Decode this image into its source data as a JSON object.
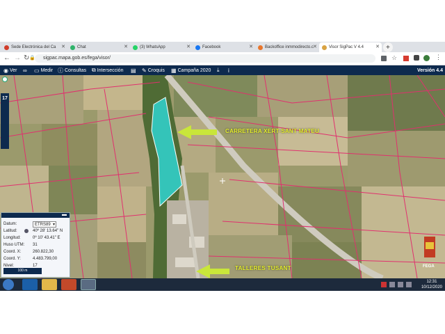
{
  "browser": {
    "tabs": [
      {
        "label": "Sede Electrónica del Ca",
        "fav_color": "#d03d2b"
      },
      {
        "label": "Chat",
        "fav_color": "#2fb36a"
      },
      {
        "label": "(3) WhatsApp",
        "fav_color": "#25d366"
      },
      {
        "label": "Facebook",
        "fav_color": "#1877f2"
      },
      {
        "label": "Backoffice inmmodirecto.c",
        "fav_color": "#e8762d"
      },
      {
        "label": "Visor SigPac V 4.4",
        "fav_color": "#d9a343"
      }
    ],
    "new_tab": "+",
    "url": "sigpac.mapa.gob.es/fega/visor/"
  },
  "toolbar": {
    "items": [
      {
        "label": "Ver",
        "icon": "eye-icon"
      },
      {
        "label": "",
        "icon": "binoculars-icon"
      },
      {
        "label": "Medir",
        "icon": "ruler-icon"
      },
      {
        "label": "Consultas",
        "icon": "info-icon"
      },
      {
        "label": "Intersección",
        "icon": "intersection-icon"
      },
      {
        "label": "",
        "icon": "print-icon"
      },
      {
        "label": "Croquis",
        "icon": "pencil-icon"
      },
      {
        "label": "Campaña 2020",
        "icon": "calendar-icon"
      },
      {
        "label": "",
        "icon": "download-icon"
      },
      {
        "label": "",
        "icon": "info-small-icon"
      }
    ],
    "version": "Versión 4.4"
  },
  "zoom_level": "17",
  "map": {
    "label_road": "CARRETERA XERT-SANT MATEU",
    "label_workshop": "TALLERES TUSANT",
    "parcel_color": "#2fd3d0",
    "arrow_color": "#c9e63a",
    "boundary_color": "#e0306e",
    "logo": "FEGA"
  },
  "coords": {
    "datum_label": "Datum:",
    "datum_value": "ETRS89",
    "lat_label": "Latitud:",
    "lat_value": "40º 28' 13.64\" N",
    "lon_label": "Longitud:",
    "lon_value": "0º 10' 43.41\" E",
    "huso_label": "Huso UTM:",
    "huso_value": "31",
    "x_label": "Coord. X:",
    "x_value": "260.822,30",
    "y_label": "Coord. Y:",
    "y_value": "4.483.799,00",
    "nivel_label": "Nivel:",
    "nivel_value": "17",
    "scale": "100 m"
  },
  "taskbar": {
    "time": "12:31",
    "date": "10/12/2020"
  }
}
